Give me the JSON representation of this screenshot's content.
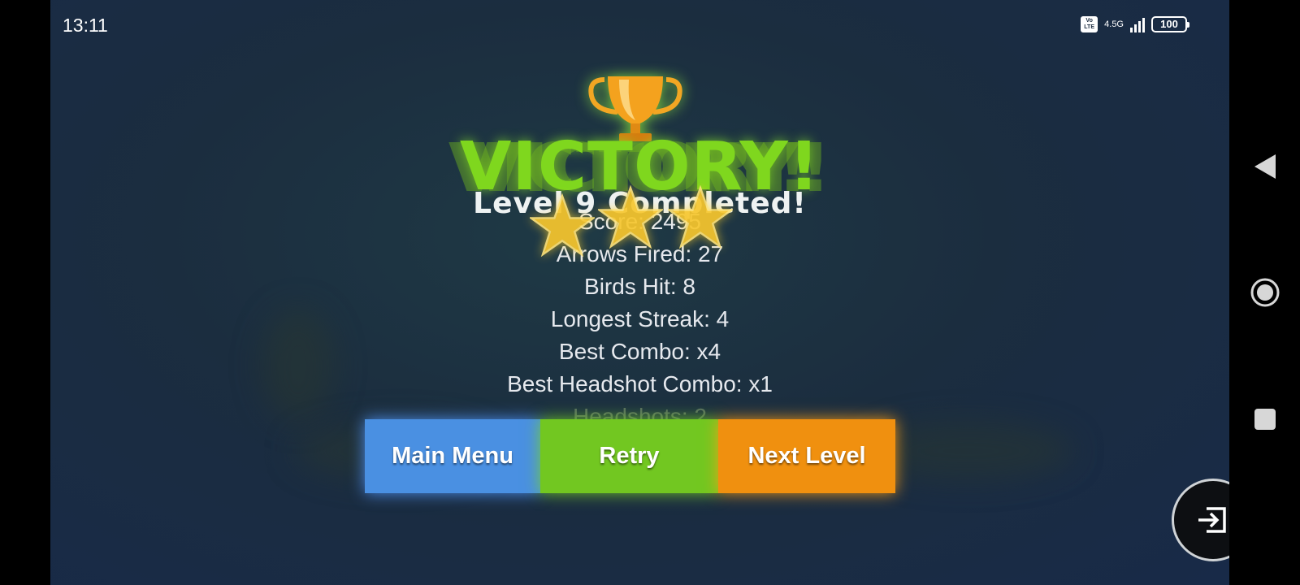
{
  "status_bar": {
    "time": "13:11",
    "network": "4.5G",
    "volte": "Vo LTE",
    "battery": "100"
  },
  "game": {
    "title": "VICTORY!",
    "subtitle": "Level 9 Completed!",
    "stars_earned": 3,
    "stats": [
      "Score: 2495",
      "Arrows Fired: 27",
      "Birds Hit: 8",
      "Longest Streak: 4",
      "Best Combo: x4",
      "Best Headshot Combo: x1",
      "Headshots: 2"
    ],
    "buttons": {
      "main_menu": "Main Menu",
      "retry": "Retry",
      "next_level": "Next Level"
    },
    "colors": {
      "victory": "#7fd71e",
      "main_menu": "#4a90e2",
      "retry": "#72c721",
      "next_level": "#f0900f"
    }
  },
  "icons": {
    "trophy": "trophy-icon",
    "star": "star-icon",
    "exit": "exit-icon",
    "nav_back": "back-triangle-icon",
    "nav_home": "home-circle-icon",
    "nav_recents": "recents-square-icon"
  }
}
